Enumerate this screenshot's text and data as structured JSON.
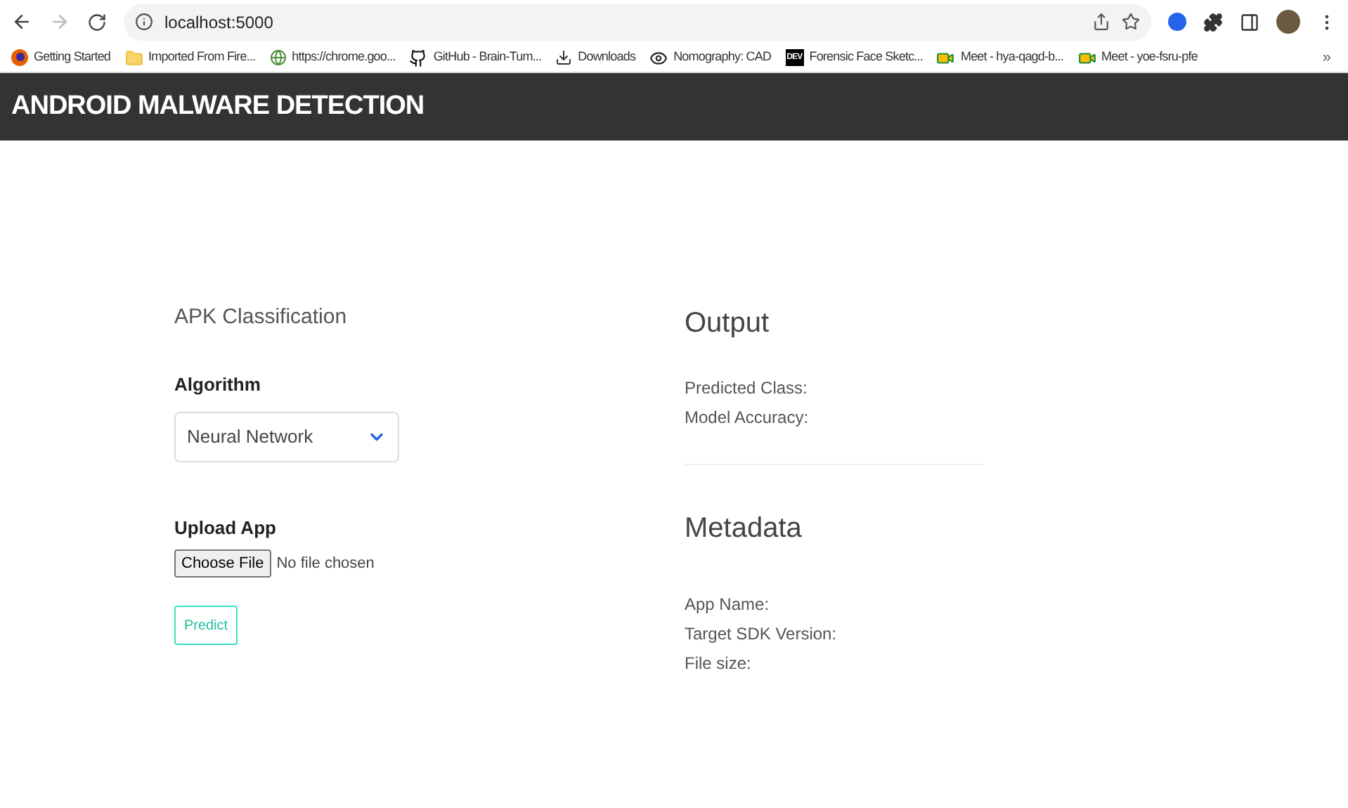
{
  "browser": {
    "url": "localhost:5000",
    "bookmarks": [
      {
        "kind": "firefox",
        "label": "Getting Started"
      },
      {
        "kind": "folder",
        "label": "Imported From Fire..."
      },
      {
        "kind": "web",
        "label": "https://chrome.goo..."
      },
      {
        "kind": "github",
        "label": "GitHub - Brain-Tum..."
      },
      {
        "kind": "download",
        "label": "Downloads"
      },
      {
        "kind": "eye",
        "label": "Nomography: CAD"
      },
      {
        "kind": "dev",
        "icon_text": "DEV",
        "label": "Forensic Face Sketc..."
      },
      {
        "kind": "meet",
        "label": "Meet - hya-qagd-b..."
      },
      {
        "kind": "meet",
        "label": "Meet - yoe-fsru-pfe"
      }
    ],
    "overflow": "»"
  },
  "header": {
    "title": "ANDROID MALWARE DETECTION"
  },
  "classification": {
    "title": "APK Classification",
    "algorithm_label": "Algorithm",
    "algorithm_value": "Neural Network",
    "upload_label": "Upload App",
    "choose_file": "Choose File",
    "file_status": "No file chosen",
    "predict": "Predict"
  },
  "output": {
    "title": "Output",
    "fields": [
      "Predicted Class:",
      "Model Accuracy:"
    ]
  },
  "metadata": {
    "title": "Metadata",
    "fields": [
      "App Name:",
      "Target SDK Version:",
      "File size:"
    ]
  }
}
